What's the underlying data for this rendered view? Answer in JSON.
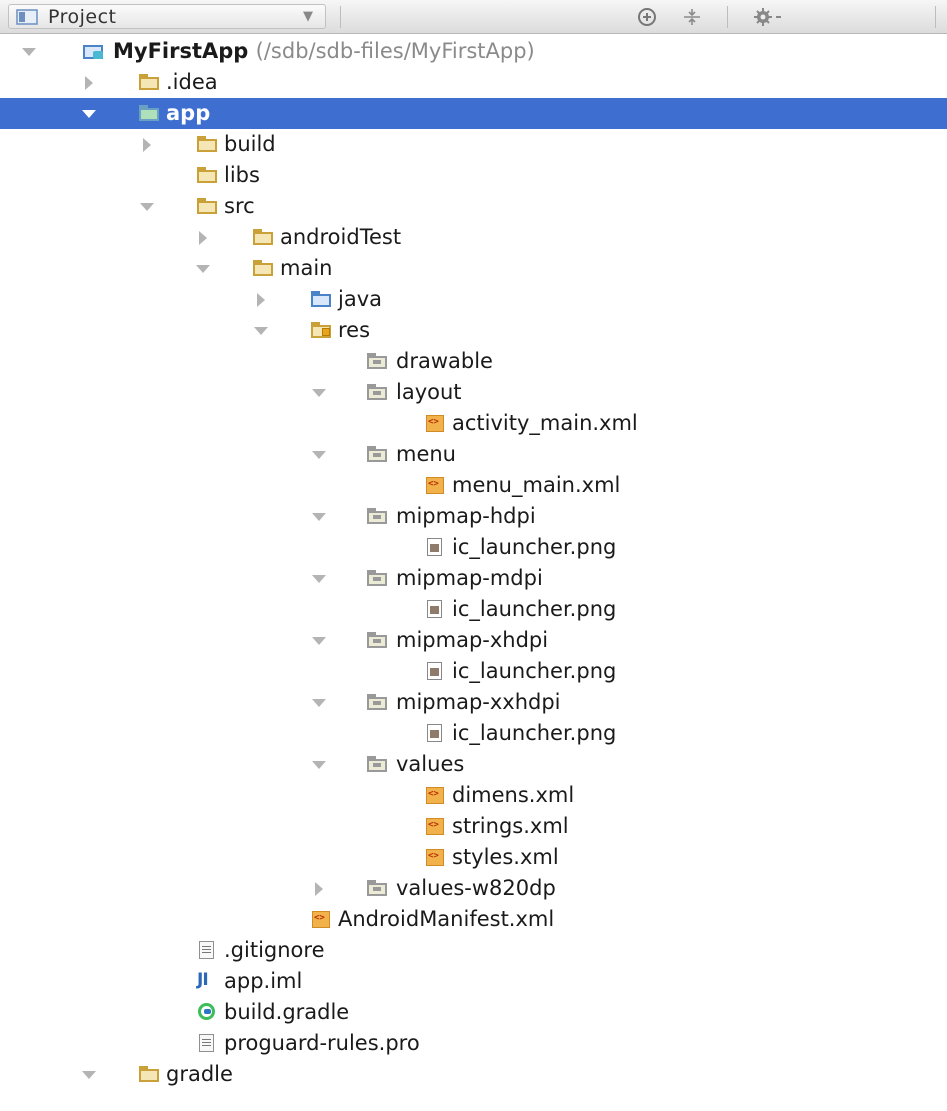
{
  "toolbar": {
    "view_label": "Project",
    "buttons": [
      "sync-icon",
      "collapse-all-icon",
      "gear-icon"
    ]
  },
  "colors": {
    "selection": "#3e6fd0",
    "path_note": "#8a8a8a"
  },
  "tree": {
    "root": {
      "label": "MyFirstApp",
      "path": "(/sdb/sdb-files/MyFirstApp)"
    },
    "items": [
      {
        "label": ".idea"
      },
      {
        "label": "app"
      },
      {
        "label": "build"
      },
      {
        "label": "libs"
      },
      {
        "label": "src"
      },
      {
        "label": "androidTest"
      },
      {
        "label": "main"
      },
      {
        "label": "java"
      },
      {
        "label": "res"
      },
      {
        "label": "drawable"
      },
      {
        "label": "layout"
      },
      {
        "label": "activity_main.xml"
      },
      {
        "label": "menu"
      },
      {
        "label": "menu_main.xml"
      },
      {
        "label": "mipmap-hdpi"
      },
      {
        "label": "ic_launcher.png"
      },
      {
        "label": "mipmap-mdpi"
      },
      {
        "label": "ic_launcher.png"
      },
      {
        "label": "mipmap-xhdpi"
      },
      {
        "label": "ic_launcher.png"
      },
      {
        "label": "mipmap-xxhdpi"
      },
      {
        "label": "ic_launcher.png"
      },
      {
        "label": "values"
      },
      {
        "label": "dimens.xml"
      },
      {
        "label": "strings.xml"
      },
      {
        "label": "styles.xml"
      },
      {
        "label": "values-w820dp"
      },
      {
        "label": "AndroidManifest.xml"
      },
      {
        "label": ".gitignore"
      },
      {
        "label": "app.iml"
      },
      {
        "label": "build.gradle"
      },
      {
        "label": "proguard-rules.pro"
      },
      {
        "label": "gradle"
      }
    ]
  }
}
